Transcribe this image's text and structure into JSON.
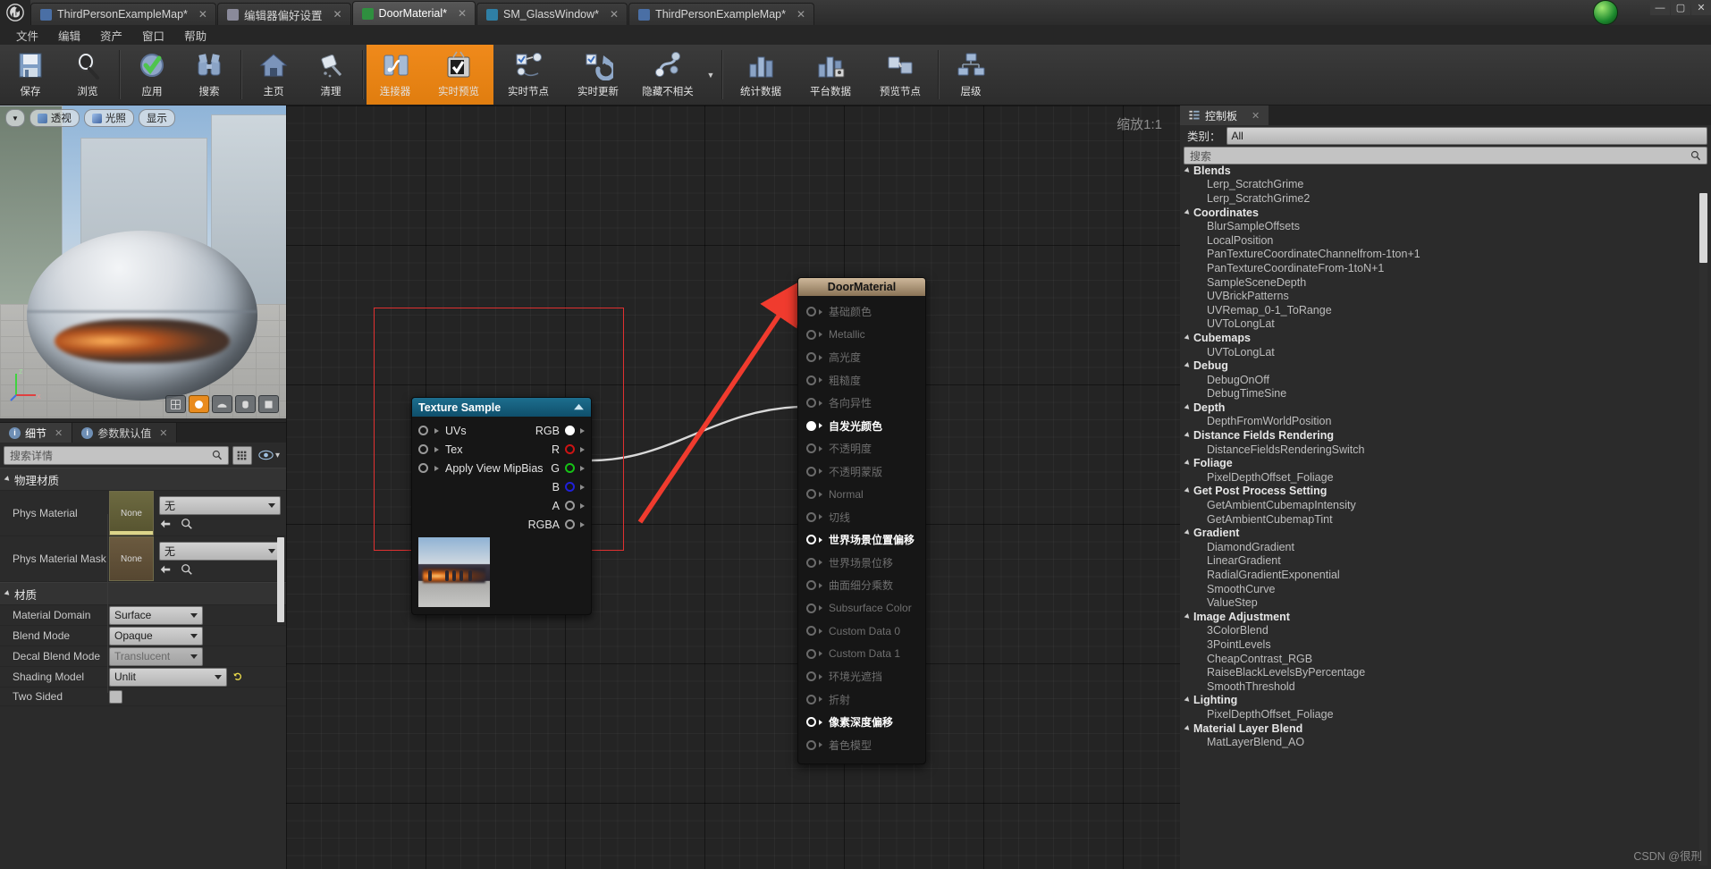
{
  "window": {
    "tabs": [
      {
        "label": "ThirdPersonExampleMap*",
        "icon": "map-icon",
        "color": "#4a6fa5",
        "active": false
      },
      {
        "label": "编辑器偏好设置",
        "icon": "prefs-icon",
        "color": "#8a8a9a",
        "active": false
      },
      {
        "label": "DoorMaterial*",
        "icon": "material-icon",
        "color": "#2f8f3f",
        "active": true
      },
      {
        "label": "SM_GlassWindow*",
        "icon": "mesh-icon",
        "color": "#2f7fa5",
        "active": false
      },
      {
        "label": "ThirdPersonExampleMap*",
        "icon": "map-icon",
        "color": "#4a6fa5",
        "active": false
      }
    ],
    "controls": {
      "minimize": "—",
      "maximize": "▢",
      "close": "✕"
    }
  },
  "menu": {
    "items": [
      "文件",
      "编辑",
      "资产",
      "窗口",
      "帮助"
    ]
  },
  "toolbar": {
    "items": [
      {
        "label": "保存",
        "icon": "save-icon",
        "highlight": false
      },
      {
        "label": "浏览",
        "icon": "browse-icon",
        "highlight": false
      },
      {
        "label": "应用",
        "icon": "apply-check-icon",
        "highlight": false
      },
      {
        "label": "搜索",
        "icon": "search-binoculars-icon",
        "highlight": false
      },
      {
        "label": "主页",
        "icon": "home-icon",
        "highlight": false
      },
      {
        "label": "清理",
        "icon": "clean-icon",
        "highlight": false
      },
      {
        "label": "连接器",
        "icon": "connectors-icon",
        "highlight": true
      },
      {
        "label": "实时预览",
        "icon": "live-preview-icon",
        "highlight": true
      },
      {
        "label": "实时节点",
        "icon": "live-nodes-icon",
        "highlight": false
      },
      {
        "label": "实时更新",
        "icon": "live-update-icon",
        "highlight": false
      },
      {
        "label": "隐藏不相关",
        "icon": "hide-unrelated-icon",
        "highlight": false
      },
      {
        "label": "统计数据",
        "icon": "stats-icon",
        "highlight": false
      },
      {
        "label": "平台数据",
        "icon": "platform-stats-icon",
        "highlight": false
      },
      {
        "label": "预览节点",
        "icon": "preview-node-icon",
        "highlight": false
      },
      {
        "label": "层级",
        "icon": "hierarchy-icon",
        "highlight": false
      }
    ]
  },
  "viewport": {
    "buttons": [
      {
        "label": "",
        "name": "viewport-options-caret"
      },
      {
        "label": "透视",
        "name": "perspective-button"
      },
      {
        "label": "光照",
        "name": "lit-button"
      },
      {
        "label": "显示",
        "name": "show-button"
      }
    ],
    "axis": {
      "z": "Z",
      "x": "X",
      "y": "Y"
    }
  },
  "graph": {
    "zoom_label": "缩放1:1",
    "texture_sample_node": {
      "title": "Texture Sample",
      "inputs": [
        "UVs",
        "Tex",
        "Apply View MipBias"
      ],
      "outputs": [
        {
          "label": "RGB",
          "color": "#ffffff",
          "filled": true
        },
        {
          "label": "R",
          "color": "#cc1414",
          "filled": false
        },
        {
          "label": "G",
          "color": "#16c116",
          "filled": false
        },
        {
          "label": "B",
          "color": "#2020d8",
          "filled": false
        },
        {
          "label": "A",
          "color": "#9a9a9a",
          "filled": false
        },
        {
          "label": "RGBA",
          "color": "#9a9a9a",
          "filled": false
        }
      ]
    },
    "door_material_node": {
      "title": "DoorMaterial",
      "pins": [
        {
          "label": "基础颜色",
          "state": "off"
        },
        {
          "label": "Metallic",
          "state": "off"
        },
        {
          "label": "高光度",
          "state": "off"
        },
        {
          "label": "粗糙度",
          "state": "off"
        },
        {
          "label": "各向异性",
          "state": "off"
        },
        {
          "label": "自发光颜色",
          "state": "connected"
        },
        {
          "label": "不透明度",
          "state": "off"
        },
        {
          "label": "不透明蒙版",
          "state": "off"
        },
        {
          "label": "Normal",
          "state": "off"
        },
        {
          "label": "切线",
          "state": "off"
        },
        {
          "label": "世界场景位置偏移",
          "state": "on"
        },
        {
          "label": "世界场景位移",
          "state": "off"
        },
        {
          "label": "曲面细分乘数",
          "state": "off"
        },
        {
          "label": "Subsurface Color",
          "state": "off"
        },
        {
          "label": "Custom Data 0",
          "state": "off"
        },
        {
          "label": "Custom Data 1",
          "state": "off"
        },
        {
          "label": "环境光遮挡",
          "state": "off"
        },
        {
          "label": "折射",
          "state": "off"
        },
        {
          "label": "像素深度偏移",
          "state": "on"
        },
        {
          "label": "着色模型",
          "state": "off"
        }
      ]
    },
    "annotation": {
      "arrow_color": "#f03b2e",
      "selection_color": "#e03030"
    }
  },
  "details": {
    "tabs": [
      {
        "label": "细节",
        "active": true
      },
      {
        "label": "参数默认值",
        "active": false
      }
    ],
    "search_placeholder": "搜索详情",
    "sections": [
      {
        "title": "物理材质",
        "rows": [
          {
            "label": "Phys Material",
            "thumb": "None",
            "value": "无",
            "disabled": false
          },
          {
            "label": "Phys Material Mask",
            "thumb": "None",
            "value": "无",
            "disabled": false
          }
        ]
      },
      {
        "title": "材质",
        "rows": [
          {
            "label": "Material Domain",
            "value": "Surface",
            "disabled": false
          },
          {
            "label": "Blend Mode",
            "value": "Opaque",
            "disabled": false
          },
          {
            "label": "Decal Blend Mode",
            "value": "Translucent",
            "disabled": true
          },
          {
            "label": "Shading Model",
            "value": "Unlit",
            "disabled": false,
            "reset": true
          },
          {
            "label": "Two Sided",
            "value": "",
            "checkbox": true
          }
        ]
      }
    ]
  },
  "palette": {
    "tab_label": "控制板",
    "category_label": "类别：",
    "category_value": "All",
    "search_placeholder": "搜索",
    "groups": [
      {
        "name": "Blends",
        "items": [
          "Lerp_ScratchGrime",
          "Lerp_ScratchGrime2"
        ]
      },
      {
        "name": "Coordinates",
        "items": [
          "BlurSampleOffsets",
          "LocalPosition",
          "PanTextureCoordinateChannelfrom-1ton+1",
          "PanTextureCoordinateFrom-1toN+1",
          "SampleSceneDepth",
          "UVBrickPatterns",
          "UVRemap_0-1_ToRange",
          "UVToLongLat"
        ]
      },
      {
        "name": "Cubemaps",
        "items": [
          "UVToLongLat"
        ]
      },
      {
        "name": "Debug",
        "items": [
          "DebugOnOff",
          "DebugTimeSine"
        ]
      },
      {
        "name": "Depth",
        "items": [
          "DepthFromWorldPosition"
        ]
      },
      {
        "name": "Distance Fields Rendering",
        "items": [
          "DistanceFieldsRenderingSwitch"
        ]
      },
      {
        "name": "Foliage",
        "items": [
          "PixelDepthOffset_Foliage"
        ]
      },
      {
        "name": "Get Post Process Setting",
        "items": [
          "GetAmbientCubemapIntensity",
          "GetAmbientCubemapTint"
        ]
      },
      {
        "name": "Gradient",
        "items": [
          "DiamondGradient",
          "LinearGradient",
          "RadialGradientExponential",
          "SmoothCurve",
          "ValueStep"
        ]
      },
      {
        "name": "Image Adjustment",
        "items": [
          "3ColorBlend",
          "3PointLevels",
          "CheapContrast_RGB",
          "RaiseBlackLevelsByPercentage",
          "SmoothThreshold"
        ]
      },
      {
        "name": "Lighting",
        "items": [
          "PixelDepthOffset_Foliage"
        ]
      },
      {
        "name": "Material Layer Blend",
        "items": [
          "MatLayerBlend_AO"
        ]
      }
    ],
    "watermark": "CSDN @很刑"
  }
}
